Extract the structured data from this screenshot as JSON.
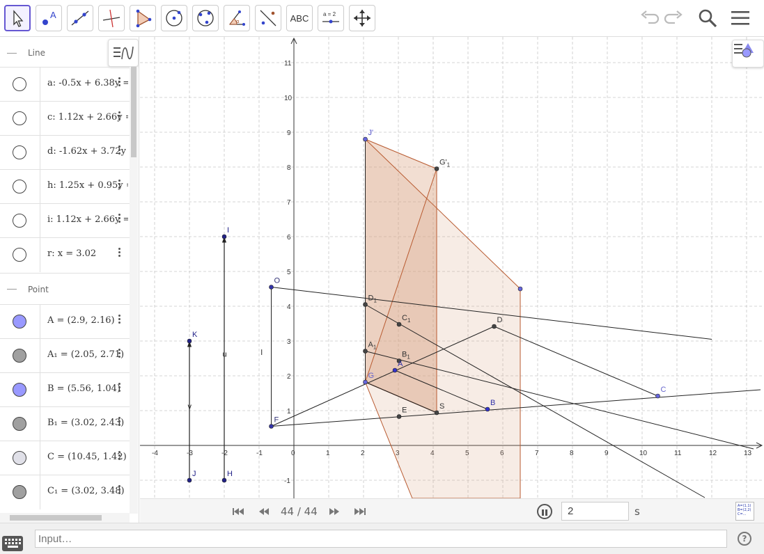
{
  "toolbar": {
    "tools": [
      {
        "id": "move",
        "name": "move-tool",
        "active": true
      },
      {
        "id": "point",
        "name": "point-tool",
        "label": "A"
      },
      {
        "id": "line",
        "name": "line-tool"
      },
      {
        "id": "perp",
        "name": "perpendicular-line-tool"
      },
      {
        "id": "polygon",
        "name": "polygon-tool"
      },
      {
        "id": "circle",
        "name": "circle-tool"
      },
      {
        "id": "conic",
        "name": "conic-tool"
      },
      {
        "id": "angle",
        "name": "angle-tool"
      },
      {
        "id": "reflect",
        "name": "reflect-tool"
      },
      {
        "id": "text",
        "name": "text-tool",
        "label": "ABC"
      },
      {
        "id": "slider",
        "name": "slider-tool",
        "label": "a = 2"
      },
      {
        "id": "pan",
        "name": "move-graphics-tool"
      }
    ],
    "undo_icon": "undo-icon",
    "redo_icon": "redo-icon",
    "search_icon": "search-icon",
    "menu_icon": "hamburger-menu-icon"
  },
  "algebra": {
    "groups": [
      {
        "label": "Line",
        "items": [
          {
            "name": "a",
            "expr": "a: -0.5x + 6.38y = ",
            "color": "#ffffff"
          },
          {
            "name": "c",
            "expr": "c: 1.12x + 2.66y = ",
            "color": "#ffffff"
          },
          {
            "name": "d",
            "expr": "d: -1.62x + 3.72y = ",
            "color": "#ffffff"
          },
          {
            "name": "h",
            "expr": "h: 1.25x + 0.95y = ",
            "color": "#ffffff"
          },
          {
            "name": "i",
            "expr": "i: 1.12x + 2.66y = ",
            "color": "#ffffff"
          },
          {
            "name": "r",
            "expr": "r: x = 3.02",
            "color": "#ffffff"
          }
        ]
      },
      {
        "label": "Point",
        "items": [
          {
            "name": "A",
            "expr": "A = (2.9, 2.16)",
            "color": "#9999ff"
          },
          {
            "name": "A1",
            "expr": "A₁ = (2.05, 2.71)",
            "color": "#a0a0a0"
          },
          {
            "name": "B",
            "expr": "B = (5.56, 1.04)",
            "color": "#9999ff"
          },
          {
            "name": "B1",
            "expr": "B₁ = (3.02, 2.43)",
            "color": "#a0a0a0"
          },
          {
            "name": "C",
            "expr": "C = (10.45, 1.42)",
            "color": "#e0e0e8"
          },
          {
            "name": "C1",
            "expr": "C₁ = (3.02, 3.48)",
            "color": "#a0a0a0"
          }
        ]
      }
    ]
  },
  "graphics": {
    "x_ticks": [
      "-4",
      "-3",
      "-2",
      "-1",
      "0",
      "1",
      "2",
      "3",
      "4",
      "5",
      "6",
      "7",
      "8",
      "9",
      "10",
      "11",
      "12",
      "13"
    ],
    "y_ticks": [
      "-1",
      "1",
      "2",
      "3",
      "4",
      "5",
      "6",
      "7",
      "8",
      "9",
      "10",
      "11"
    ],
    "points": [
      {
        "label": "J'",
        "x": 2.05,
        "y": 8.8,
        "color": "#6666dd",
        "label_color": "#5555cc"
      },
      {
        "label": "G'",
        "sub": "1",
        "x": 4.1,
        "y": 7.95,
        "color": "#444444",
        "label_color": "#333333"
      },
      {
        "label": "I",
        "x": -2,
        "y": 6,
        "color": "#222288",
        "label_color": "#222288"
      },
      {
        "label": "O",
        "x": -0.65,
        "y": 4.55,
        "color": "#3333aa",
        "label_color": "#333377"
      },
      {
        "label": "",
        "x": 6.5,
        "y": 4.5,
        "color": "#6666dd",
        "label_color": "#333333"
      },
      {
        "label": "D",
        "sub": "1",
        "x": 2.05,
        "y": 4.05,
        "color": "#444444",
        "label_color": "#333333"
      },
      {
        "label": "C",
        "sub": "1",
        "x": 3.02,
        "y": 3.48,
        "color": "#444444",
        "label_color": "#333333"
      },
      {
        "label": "D",
        "x": 5.75,
        "y": 3.42,
        "color": "#444444",
        "label_color": "#333333"
      },
      {
        "label": "K",
        "x": -3,
        "y": 3,
        "color": "#222288",
        "label_color": "#222288"
      },
      {
        "label": "A",
        "sub": "1",
        "x": 2.05,
        "y": 2.71,
        "color": "#444444",
        "label_color": "#333333"
      },
      {
        "label": "B",
        "sub": "1",
        "x": 3.02,
        "y": 2.43,
        "color": "#444444",
        "label_color": "#333333"
      },
      {
        "label": "A",
        "x": 2.9,
        "y": 2.16,
        "color": "#3333cc",
        "label_color": "#3333aa"
      },
      {
        "label": "G",
        "x": 2.05,
        "y": 1.82,
        "color": "#6666dd",
        "label_color": "#6666cc"
      },
      {
        "label": "C",
        "x": 10.45,
        "y": 1.42,
        "color": "#6666dd",
        "label_color": "#6666cc"
      },
      {
        "label": "B",
        "x": 5.56,
        "y": 1.04,
        "color": "#3333cc",
        "label_color": "#3333aa"
      },
      {
        "label": "S",
        "x": 4.1,
        "y": 0.94,
        "color": "#444444",
        "label_color": "#333333"
      },
      {
        "label": "E",
        "x": 3.02,
        "y": 0.83,
        "color": "#444444",
        "label_color": "#333333"
      },
      {
        "label": "F",
        "x": -0.65,
        "y": 0.55,
        "color": "#3333aa",
        "label_color": "#333377"
      },
      {
        "label": "J",
        "x": -3,
        "y": -1,
        "color": "#222288",
        "label_color": "#222288"
      },
      {
        "label": "H",
        "x": -2,
        "y": -1,
        "color": "#222288",
        "label_color": "#222288"
      }
    ],
    "vector_labels": [
      {
        "label": "v",
        "x": -3.05,
        "y": 1.05
      },
      {
        "label": "u",
        "x": -2.05,
        "y": 2.55
      },
      {
        "label": "l",
        "x": -0.95,
        "y": 2.6
      }
    ]
  },
  "animation": {
    "frame_label": "44 / 44",
    "speed_value": "2",
    "speed_unit": "s",
    "first_icon": "skip-first-icon",
    "prev_icon": "step-back-icon",
    "next_icon": "step-forward-icon",
    "last_icon": "skip-last-icon",
    "pause_icon": "pause-icon",
    "table_icon": "table-of-values-icon"
  },
  "inputbar": {
    "placeholder": "Input…",
    "keyboard_icon": "keyboard-icon",
    "help_label": "?"
  }
}
